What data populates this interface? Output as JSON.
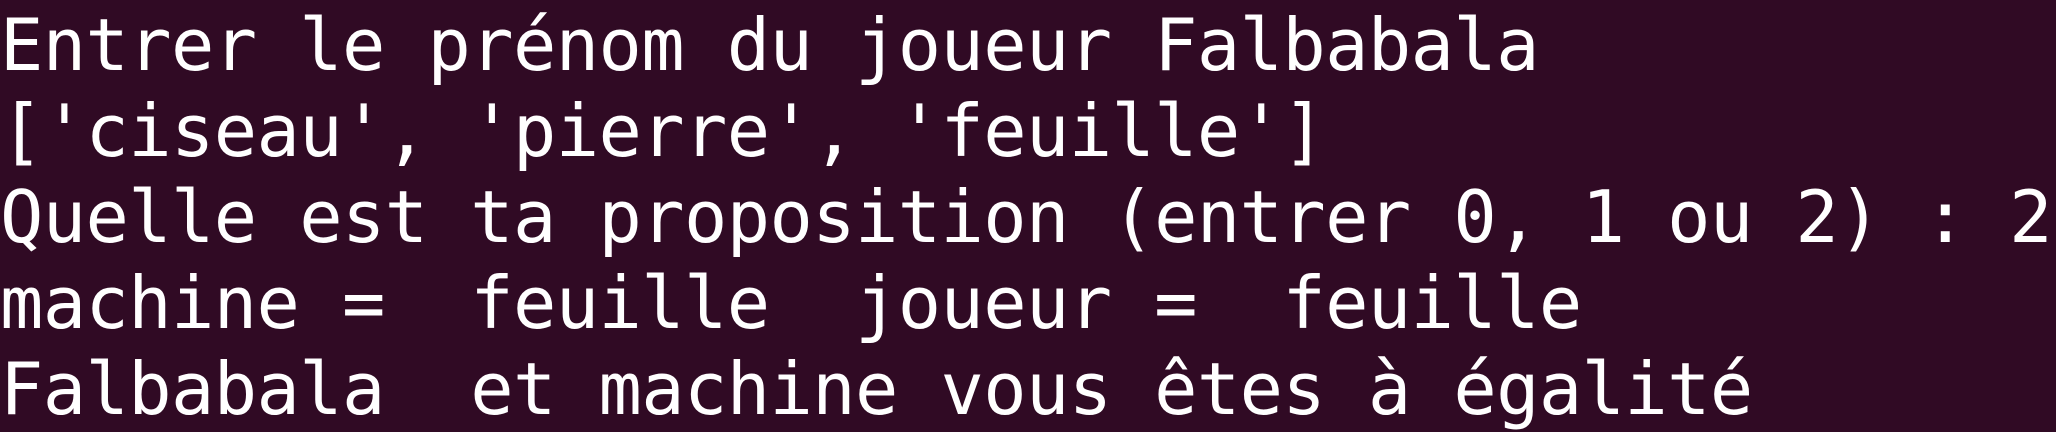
{
  "terminal": {
    "lines": [
      "Entrer le prénom du joueur Falbabala",
      "['ciseau', 'pierre', 'feuille']",
      "Quelle est ta proposition (entrer 0, 1 ou 2) : 2",
      "machine =  feuille  joueur =  feuille",
      "Falbabala  et machine vous êtes à égalité"
    ],
    "colors": {
      "background": "#300a24",
      "text": "#ffffff"
    }
  }
}
